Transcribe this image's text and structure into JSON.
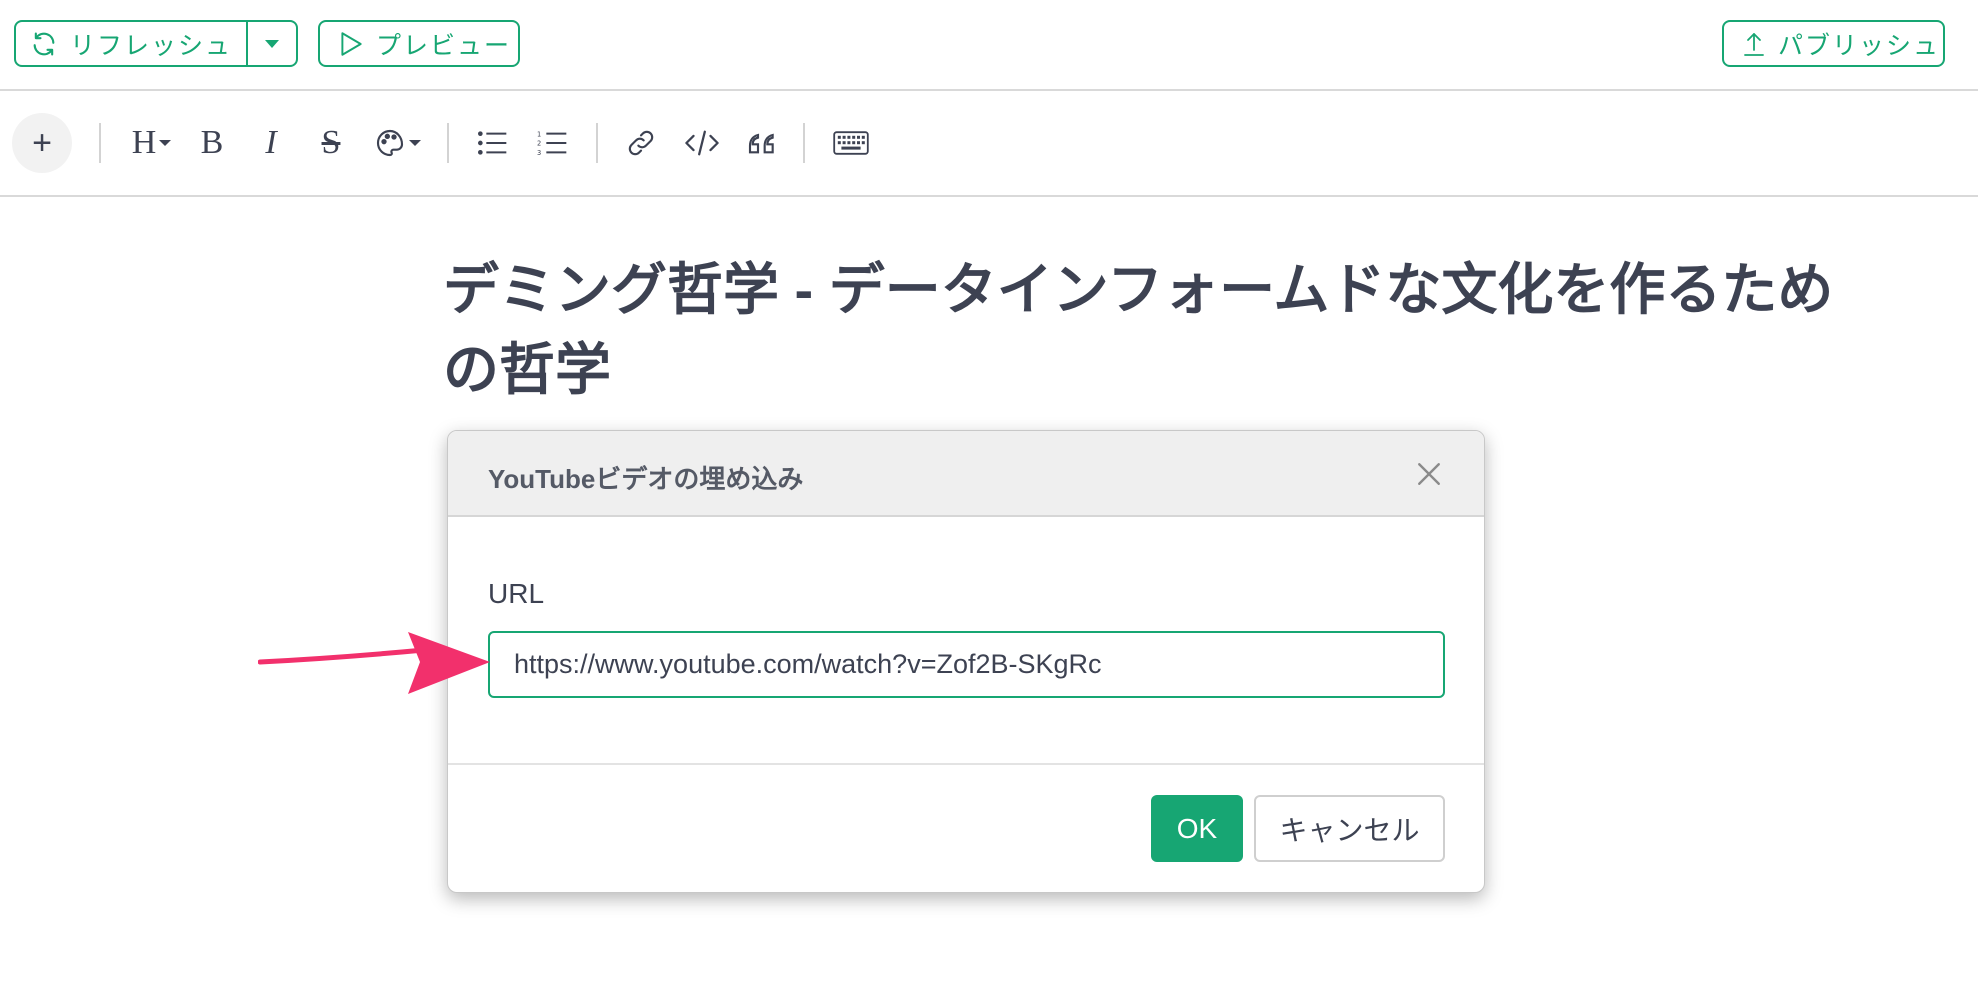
{
  "topbar": {
    "refresh_label": "リフレッシュ",
    "preview_label": "プレビュー",
    "publish_label": "パブリッシュ"
  },
  "toolbar": {
    "add_label": "+",
    "heading_label": "H",
    "bold_label": "B",
    "italic_label": "I",
    "strikethrough_label": "S"
  },
  "document": {
    "title": "デミング哲学 - データインフォームドな文化を作るための哲学"
  },
  "modal": {
    "title": "YouTubeビデオの埋め込み",
    "url_label": "URL",
    "url_value": "https://www.youtube.com/watch?v=Zof2B-SKgRc",
    "ok_label": "OK",
    "cancel_label": "キャンセル"
  },
  "colors": {
    "accent": "#17a673",
    "text": "#3d4252",
    "annotation_arrow": "#f2306c"
  }
}
